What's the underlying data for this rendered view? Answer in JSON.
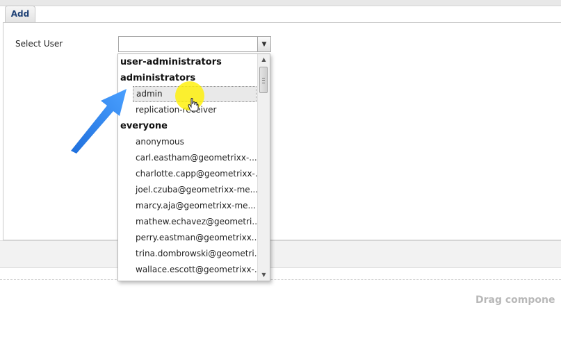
{
  "tab": {
    "label": "Add"
  },
  "form": {
    "select_user_label": "Select User",
    "select_user_value": "",
    "trigger_icon": "chevron-down-icon"
  },
  "dropdown": {
    "groups": [
      {
        "label": "user-administrators",
        "items": []
      },
      {
        "label": "administrators",
        "items": [
          "admin",
          "replication-receiver"
        ]
      },
      {
        "label": "everyone",
        "items": [
          "anonymous",
          "carl.eastham@geometrixx-...",
          "charlotte.capp@geometrixx-...",
          "joel.czuba@geometrixx-me...",
          "marcy.aja@geometrixx-me...",
          "mathew.echavez@geometri...",
          "perry.eastman@geometrixx...",
          "trina.dombrowski@geometri...",
          "wallace.escott@geometrixx-..."
        ]
      }
    ],
    "highlighted_item": "admin"
  },
  "drop_zone": {
    "text": "Drag compone"
  },
  "colors": {
    "tab_text": "#1c3f74",
    "pointer_arrow": "#2f86f0",
    "cursor_highlight": "#fff000"
  },
  "icons": {
    "pointer": "blue-arrow-icon",
    "cursor": "hand-cursor-icon",
    "scroll_up": "scroll-up-icon",
    "scroll_down": "scroll-down-icon"
  }
}
